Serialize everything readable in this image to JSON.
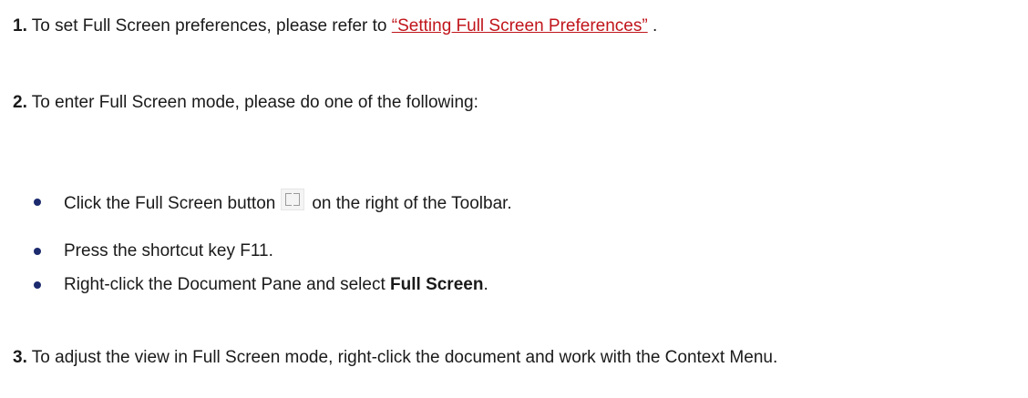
{
  "step1": {
    "number": "1.",
    "text": " To set Full Screen preferences, please refer to ",
    "link": "“Setting Full Screen Preferences”",
    "after": " ."
  },
  "step2": {
    "number": "2.",
    "text": " To enter Full Screen mode, please do one of the following:"
  },
  "bullets": [
    {
      "before_icon": "Click the Full Screen button",
      "icon": "full-screen-icon",
      "after_icon": "on the right of the Toolbar."
    },
    {
      "text": "Press the shortcut key F11."
    },
    {
      "before_bold": "Right-click the Document Pane and select ",
      "bold": "Full Screen",
      "after_bold": "."
    }
  ],
  "step3": {
    "number": "3.",
    "text": " To adjust the view in Full Screen mode, right-click the document and work with the Context Menu."
  },
  "colors": {
    "link": "#c0151b",
    "bullet": "#1c2a6e",
    "text": "#1a1a1a"
  }
}
